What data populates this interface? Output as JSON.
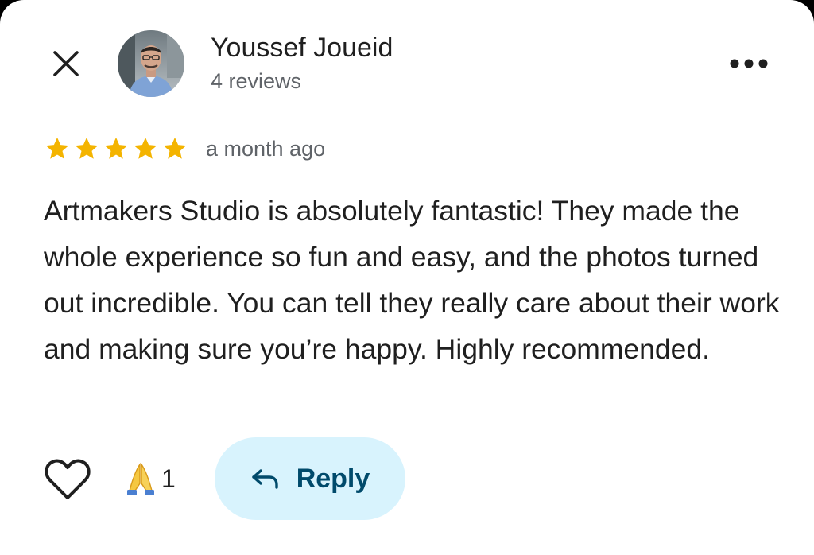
{
  "author": {
    "name": "Youssef Joueid",
    "reviews_label": "4 reviews"
  },
  "review": {
    "rating": 5,
    "max_rating": 5,
    "time_ago": "a month ago",
    "text": "Artmakers Studio is absolutely fantastic! They made the whole experience so fun and easy, and the photos turned out incredible. You can tell they really care about their work and making sure you’re happy. Highly recommended."
  },
  "actions": {
    "reaction_emoji": "🙏",
    "reaction_count": "1",
    "reply_label": "Reply"
  },
  "icons": {
    "close": "close-icon",
    "more": "more-horizontal-icon",
    "like": "heart-outline-icon",
    "reply": "reply-arrow-icon",
    "star": "star-icon"
  },
  "colors": {
    "star": "#F4B400",
    "reply_bg": "#D8F3FD",
    "reply_text": "#004A6B",
    "secondary_text": "#5F6368"
  }
}
